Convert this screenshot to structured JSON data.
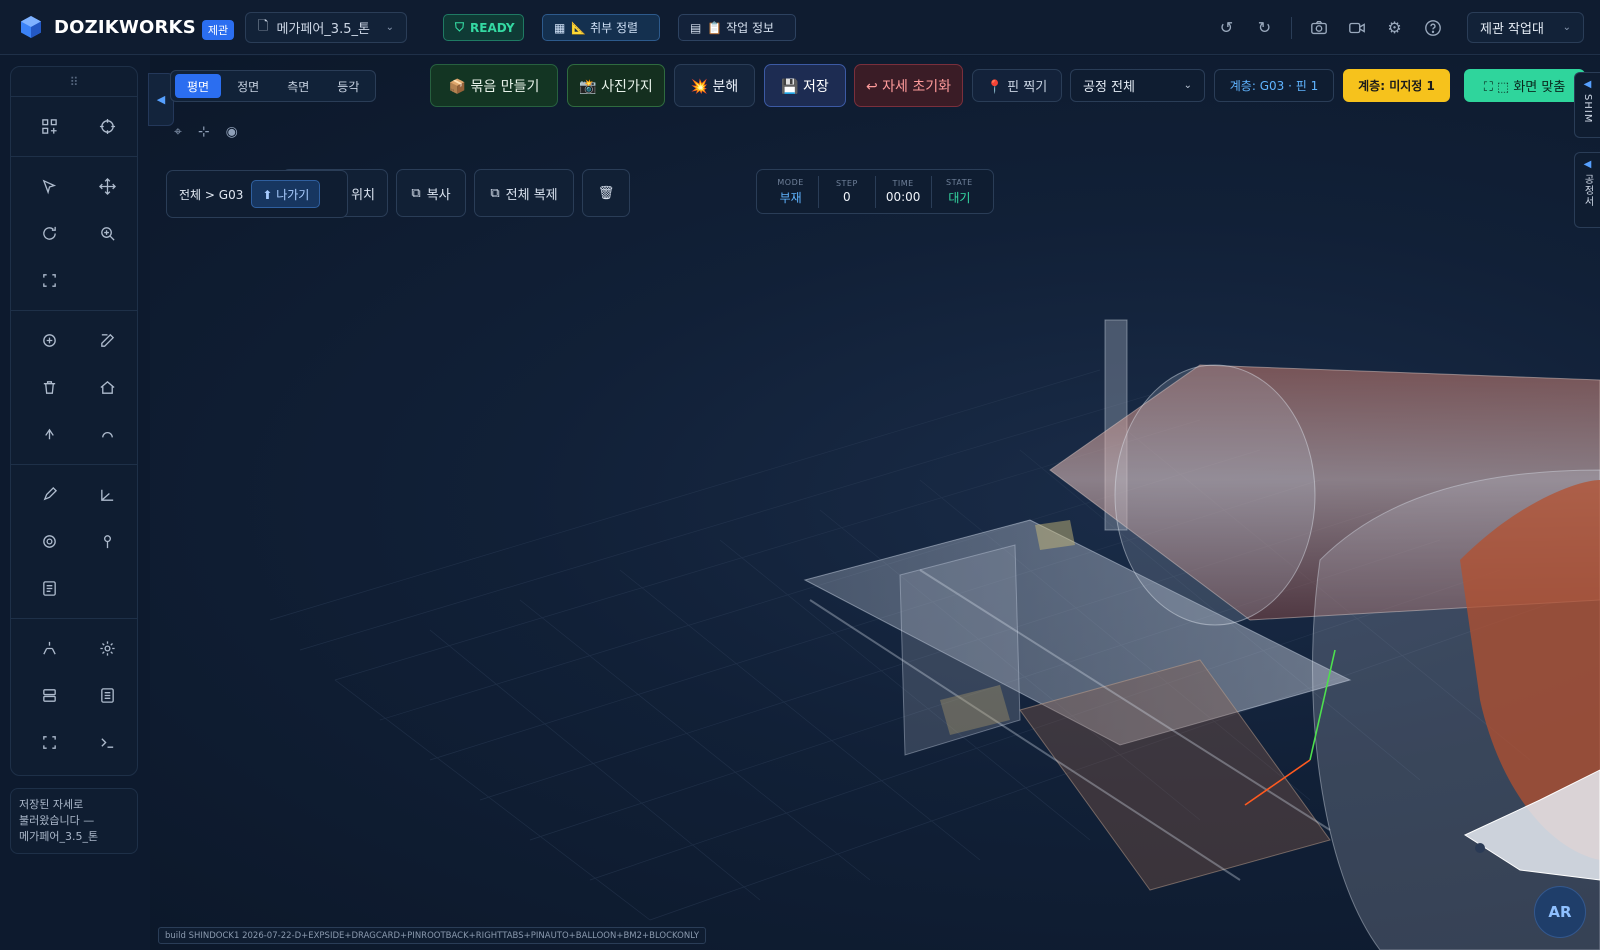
{
  "brand": {
    "name": "DOZIKWORKS",
    "badge": "제관"
  },
  "file": {
    "name": "메가페어_3.5_톤"
  },
  "status": {
    "ready": "READY",
    "align": "📐 취부 정렬",
    "info": "📋 작업 정보"
  },
  "user": {
    "label": "제관 작업대"
  },
  "view_tabs": [
    "평면",
    "정면",
    "측면",
    "등각"
  ],
  "actions": {
    "group": "📦 묶음 만들기",
    "photo": "📸 사진가지",
    "explode": "💥 분해",
    "save": "💾 저장",
    "reset": "↩ 자세 초기화",
    "pin": "📍 핀 찍기",
    "process_select": "공정 전체",
    "layer": "계층: G03 · 핀 1",
    "undefined": "계층: 미지정 1",
    "fit": "⛶ ⬚ 화면 맞춤"
  },
  "right_tabs": {
    "shim": "SHIM",
    "process": "공정서"
  },
  "breadcrumb": {
    "path": "전체 > G03",
    "back": "⬆ 나가기"
  },
  "ghost": {
    "position": "위치",
    "copy": "복사",
    "duplicate_all": "전체 복제"
  },
  "hud": {
    "mode_k": "MODE",
    "mode_v": "부재",
    "step_k": "STEP",
    "step_v": "0",
    "time_k": "TIME",
    "time_v": "00:00",
    "state_k": "STATE",
    "state_v": "대기"
  },
  "status_card": {
    "line1": "저장된 자세로",
    "line2": "불러왔습니다 —",
    "line3": "메가페어_3.5_톤"
  },
  "build": "build SHINDOCK1 2026-07-22-D+EXPSIDE+DRAGCARD+PINROOTBACK+RIGHTTABS+PINAUTO+BALLOON+BM2+BLOCKONLY",
  "ar": "AR",
  "colors": {
    "accent": "#2b6ef0",
    "ready": "#34d9a2",
    "warn": "#f6c21c",
    "fit": "#2fd59c",
    "danger": "#ff9b9b"
  }
}
